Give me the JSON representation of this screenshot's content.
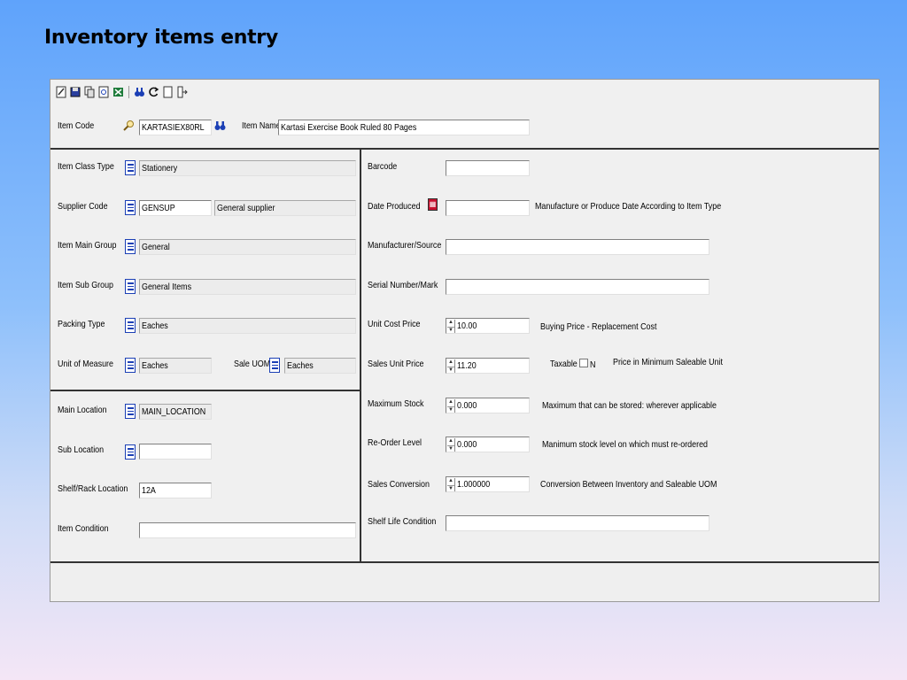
{
  "slide": {
    "title": "Inventory items entry"
  },
  "toolbar": {
    "icons": [
      "edit-icon",
      "save-icon",
      "copy-icon",
      "print-preview-icon",
      "excel-icon",
      "search-binoculars-icon",
      "refresh-icon",
      "blank-page-icon",
      "exit-icon"
    ]
  },
  "header": {
    "item_code_label": "Item Code",
    "item_code_value": "KARTASIEX80RL",
    "item_name_label": "Item Name",
    "item_name_value": "Kartasi Exercise Book  Ruled 80 Pages"
  },
  "left": {
    "item_class_type": {
      "label": "Item Class Type",
      "value": "Stationery"
    },
    "supplier_code": {
      "label": "Supplier Code",
      "value": "GENSUP",
      "name": "General supplier"
    },
    "item_main_group": {
      "label": "Item Main Group",
      "value": "General"
    },
    "item_sub_group": {
      "label": "Item Sub Group",
      "value": "General Items"
    },
    "packing_type": {
      "label": "Packing Type",
      "value": "Eaches"
    },
    "unit_of_measure": {
      "label": "Unit of Measure",
      "value": "Eaches"
    },
    "sale_uom": {
      "label": "Sale UOM",
      "value": "Eaches"
    },
    "main_location": {
      "label": "Main Location",
      "value": "MAIN_LOCATION"
    },
    "sub_location": {
      "label": "Sub Location",
      "value": ""
    },
    "shelf_rack_location": {
      "label": "Shelf/Rack Location",
      "value": "12A"
    },
    "item_condition": {
      "label": "Item Condition",
      "value": ""
    }
  },
  "right": {
    "barcode": {
      "label": "Barcode",
      "value": ""
    },
    "date_produced": {
      "label": "Date Produced",
      "value": "",
      "hint": "Manufacture or Produce Date According to Item Type"
    },
    "manufacturer_source": {
      "label": "Manufacturer/Source",
      "value": ""
    },
    "serial_number_mark": {
      "label": "Serial Number/Mark",
      "value": ""
    },
    "unit_cost_price": {
      "label": "Unit Cost Price",
      "value": "10.00",
      "hint": "Buying Price - Replacement Cost"
    },
    "sales_unit_price": {
      "label": "Sales Unit Price",
      "value": "11.20",
      "taxable_label": "Taxable",
      "taxable_value": "N",
      "hint": "Price in Minimum Saleable Unit"
    },
    "maximum_stock": {
      "label": "Maximum Stock",
      "value": "0.000",
      "hint": "Maximum that can be stored: wherever applicable"
    },
    "reorder_level": {
      "label": "Re-Order Level",
      "value": "0.000",
      "hint": "Manimum stock level on which must re-ordered"
    },
    "sales_conversion": {
      "label": "Sales Conversion",
      "value": "1.000000",
      "hint": "Conversion Between Inventory and Saleable UOM"
    },
    "shelf_life_condition": {
      "label": "Shelf Life Condition",
      "value": ""
    }
  }
}
